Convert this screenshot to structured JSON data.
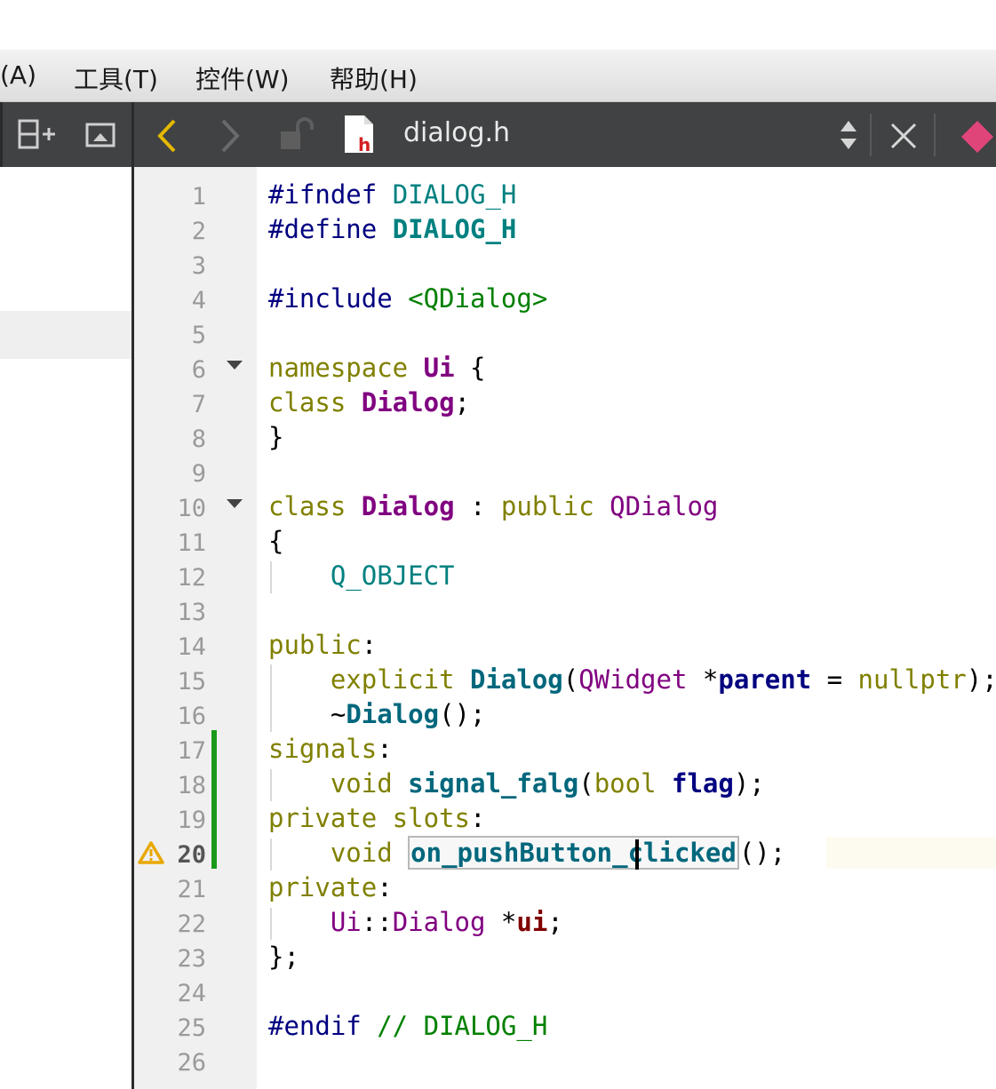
{
  "menubar": {
    "items": [
      "(A)",
      "工具(T)",
      "控件(W)",
      "帮助(H)"
    ]
  },
  "toolbar": {
    "file_name": "dialog.h",
    "file_icon_letter": "h"
  },
  "editor": {
    "current_line": 20,
    "warning_line": 20,
    "line_numbers": [
      "1",
      "2",
      "3",
      "4",
      "5",
      "6",
      "7",
      "8",
      "9",
      "10",
      "11",
      "12",
      "13",
      "14",
      "15",
      "16",
      "17",
      "18",
      "19",
      "20",
      "21",
      "22",
      "23",
      "24",
      "25",
      "26"
    ],
    "lines": [
      {
        "tokens": [
          {
            "t": "#ifndef ",
            "c": "preproc"
          },
          {
            "t": "DIALOG_H",
            "c": "macro"
          }
        ]
      },
      {
        "tokens": [
          {
            "t": "#define ",
            "c": "preproc"
          },
          {
            "t": "DIALOG_H",
            "c": "macro-b"
          }
        ]
      },
      {
        "tokens": []
      },
      {
        "tokens": [
          {
            "t": "#include ",
            "c": "preproc"
          },
          {
            "t": "<QDialog>",
            "c": "string"
          }
        ]
      },
      {
        "tokens": []
      },
      {
        "tokens": [
          {
            "t": "namespace ",
            "c": "keyword"
          },
          {
            "t": "Ui",
            "c": "type-b"
          },
          {
            "t": " {",
            "c": "plain"
          }
        ]
      },
      {
        "tokens": [
          {
            "t": "class ",
            "c": "keyword"
          },
          {
            "t": "Dialog",
            "c": "type-b"
          },
          {
            "t": ";",
            "c": "plain"
          }
        ]
      },
      {
        "tokens": [
          {
            "t": "}",
            "c": "plain"
          }
        ]
      },
      {
        "tokens": []
      },
      {
        "tokens": [
          {
            "t": "class ",
            "c": "keyword"
          },
          {
            "t": "Dialog",
            "c": "type-b"
          },
          {
            "t": " : ",
            "c": "plain"
          },
          {
            "t": "public ",
            "c": "keyword"
          },
          {
            "t": "QDialog",
            "c": "type"
          }
        ]
      },
      {
        "tokens": [
          {
            "t": "{",
            "c": "plain"
          }
        ]
      },
      {
        "tokens": [
          {
            "t": "    ",
            "c": "plain"
          },
          {
            "t": "Q_OBJECT",
            "c": "macro"
          }
        ]
      },
      {
        "tokens": []
      },
      {
        "tokens": [
          {
            "t": "public",
            "c": "keyword"
          },
          {
            "t": ":",
            "c": "plain"
          }
        ]
      },
      {
        "tokens": [
          {
            "t": "    ",
            "c": "plain"
          },
          {
            "t": "explicit ",
            "c": "keyword"
          },
          {
            "t": "Dialog",
            "c": "func"
          },
          {
            "t": "(",
            "c": "plain"
          },
          {
            "t": "QWidget",
            "c": "type"
          },
          {
            "t": " *",
            "c": "plain"
          },
          {
            "t": "parent",
            "c": "param"
          },
          {
            "t": " = ",
            "c": "plain"
          },
          {
            "t": "nullptr",
            "c": "keyword"
          },
          {
            "t": ");",
            "c": "plain"
          }
        ]
      },
      {
        "tokens": [
          {
            "t": "    ~",
            "c": "plain"
          },
          {
            "t": "Dialog",
            "c": "func"
          },
          {
            "t": "();",
            "c": "plain"
          }
        ]
      },
      {
        "tokens": [
          {
            "t": "signals",
            "c": "keyword"
          },
          {
            "t": ":",
            "c": "plain"
          }
        ]
      },
      {
        "tokens": [
          {
            "t": "    ",
            "c": "plain"
          },
          {
            "t": "void ",
            "c": "keyword"
          },
          {
            "t": "signal_falg",
            "c": "func"
          },
          {
            "t": "(",
            "c": "plain"
          },
          {
            "t": "bool ",
            "c": "keyword"
          },
          {
            "t": "flag",
            "c": "param"
          },
          {
            "t": ");",
            "c": "plain"
          }
        ]
      },
      {
        "tokens": [
          {
            "t": "private slots",
            "c": "keyword"
          },
          {
            "t": ":",
            "c": "plain"
          }
        ]
      },
      {
        "tokens": [
          {
            "t": "    ",
            "c": "plain"
          },
          {
            "t": "void ",
            "c": "keyword"
          },
          {
            "t": "on_pushButton_clicked",
            "c": "hl"
          },
          {
            "t": "();",
            "c": "plain"
          }
        ]
      },
      {
        "tokens": [
          {
            "t": "private",
            "c": "keyword"
          },
          {
            "t": ":",
            "c": "plain"
          }
        ]
      },
      {
        "tokens": [
          {
            "t": "    ",
            "c": "plain"
          },
          {
            "t": "Ui",
            "c": "type"
          },
          {
            "t": "::",
            "c": "plain"
          },
          {
            "t": "Dialog",
            "c": "type"
          },
          {
            "t": " *",
            "c": "plain"
          },
          {
            "t": "ui",
            "c": "member"
          },
          {
            "t": ";",
            "c": "plain"
          }
        ]
      },
      {
        "tokens": [
          {
            "t": "};",
            "c": "plain"
          }
        ]
      },
      {
        "tokens": []
      },
      {
        "tokens": [
          {
            "t": "#endif ",
            "c": "preproc"
          },
          {
            "t": "// DIALOG_H",
            "c": "comment"
          }
        ]
      },
      {
        "tokens": []
      }
    ]
  },
  "icons": {
    "split": "split-add-icon",
    "screen": "screen-icon",
    "back": "back-arrow-icon",
    "forward": "forward-arrow-icon",
    "lock": "unlock-icon",
    "file": "header-file-icon",
    "updown": "updown-icon",
    "close": "close-icon",
    "bookmark": "bookmark-icon",
    "warning": "warning-icon"
  },
  "colors": {
    "toolbar_bg": "#404244",
    "back_arrow": "#e6b800",
    "change_bar": "#1a9a1a",
    "warning": "#e8a800",
    "bookmark": "#e0457a"
  }
}
